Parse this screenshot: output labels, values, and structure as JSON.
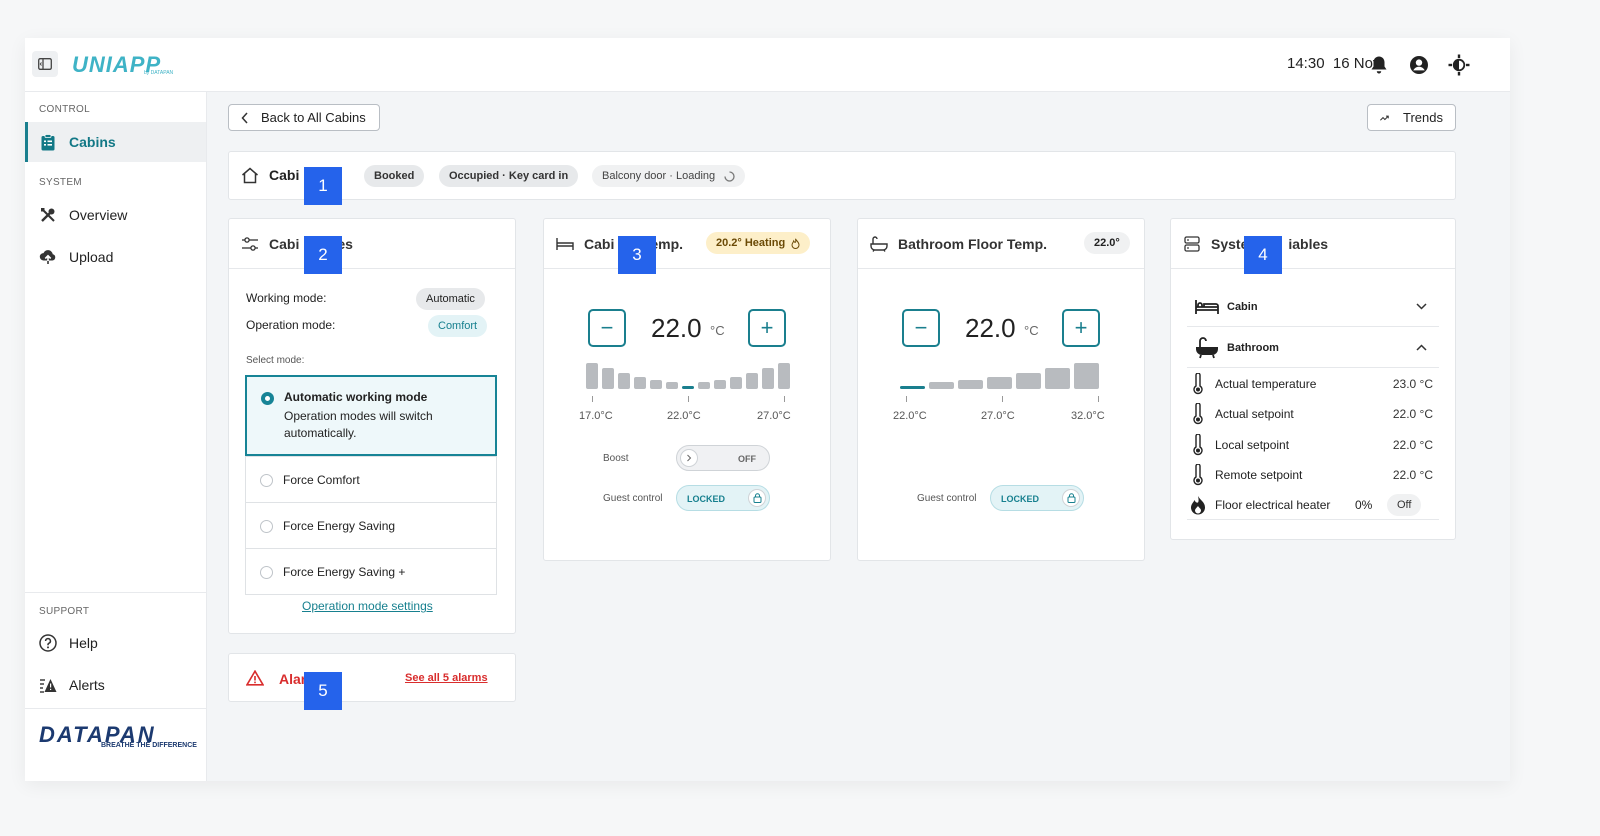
{
  "topbar": {
    "logo_text": "UNIAPP",
    "logo_sub": "by DATAPAN",
    "time": "14:30",
    "date": "16 Nov"
  },
  "sidebar": {
    "section_control": "CONTROL",
    "section_system": "SYSTEM",
    "section_support": "SUPPORT",
    "items": [
      {
        "label": "Cabins",
        "icon": "clipboard-icon",
        "active": true
      },
      {
        "label": "Overview",
        "icon": "tools-icon"
      },
      {
        "label": "Upload",
        "icon": "cloud-upload-icon"
      },
      {
        "label": "Help",
        "icon": "help-circle-icon"
      },
      {
        "label": "Alerts",
        "icon": "alerts-icon"
      }
    ],
    "footer_logo": "DATAPAN",
    "footer_tagline": "BREATHE THE DIFFERENCE"
  },
  "header": {
    "back_label": "Back to All Cabins",
    "trends_label": "Trends"
  },
  "status_bar": {
    "title": "Cabi",
    "pills": [
      "Booked",
      "Occupied · Key card in",
      "Balcony door · Loading"
    ]
  },
  "modes_card": {
    "title": "Cabi",
    "title_suffix": "es",
    "working_mode_label": "Working mode:",
    "working_mode_value": "Automatic",
    "operation_mode_label": "Operation mode:",
    "operation_mode_value": "Comfort",
    "select_label": "Select mode:",
    "options": [
      {
        "label": "Automatic working mode",
        "desc": "Operation modes will switch automatically.",
        "selected": true
      },
      {
        "label": "Force Comfort"
      },
      {
        "label": "Force Energy Saving"
      },
      {
        "label": "Force Energy Saving +"
      }
    ],
    "settings_link": "Operation mode settings"
  },
  "alarms_card": {
    "title": "Alar",
    "link": "See all 5 alarms"
  },
  "cabin_temp": {
    "title": "Cabi",
    "title_suffix": "emp.",
    "badge": "20.2° Heating",
    "value": "22.0",
    "unit": "°C",
    "scale_min": "17.0°C",
    "scale_mid": "22.0°C",
    "scale_max": "27.0°C",
    "bar_levels": [
      1.0,
      0.8,
      0.6,
      0.45,
      0.35,
      0.25,
      0.15,
      0.25,
      0.35,
      0.45,
      0.6,
      0.8,
      1.0
    ],
    "current_index": 6,
    "boost_label": "Boost",
    "boost_state": "OFF",
    "guest_label": "Guest control",
    "guest_state": "LOCKED"
  },
  "bathroom_temp": {
    "title": "Bathroom Floor Temp.",
    "badge": "22.0°",
    "value": "22.0",
    "unit": "°C",
    "scale_min": "22.0°C",
    "scale_mid": "27.0°C",
    "scale_max": "32.0°C",
    "bar_levels": [
      0.15,
      0.25,
      0.35,
      0.45,
      0.6,
      0.8,
      1.0
    ],
    "current_index": 0,
    "guest_label": "Guest control",
    "guest_state": "LOCKED"
  },
  "sysvars": {
    "title": "Syste",
    "title_suffix": "iables",
    "sections": [
      {
        "label": "Cabin",
        "expanded": false
      },
      {
        "label": "Bathroom",
        "expanded": true
      }
    ],
    "rows": [
      {
        "label": "Actual temperature",
        "value": "23.0 °C"
      },
      {
        "label": "Actual setpoint",
        "value": "22.0 °C"
      },
      {
        "label": "Local setpoint",
        "value": "22.0 °C"
      },
      {
        "label": "Remote setpoint",
        "value": "22.0 °C"
      }
    ],
    "heater_label": "Floor electrical heater",
    "heater_percent": "0%",
    "heater_state": "Off"
  },
  "markers": [
    "1",
    "2",
    "3",
    "4",
    "5"
  ],
  "colors": {
    "accent": "#1a7f8e",
    "alarm": "#d92d2d",
    "marker": "#2563eb"
  }
}
